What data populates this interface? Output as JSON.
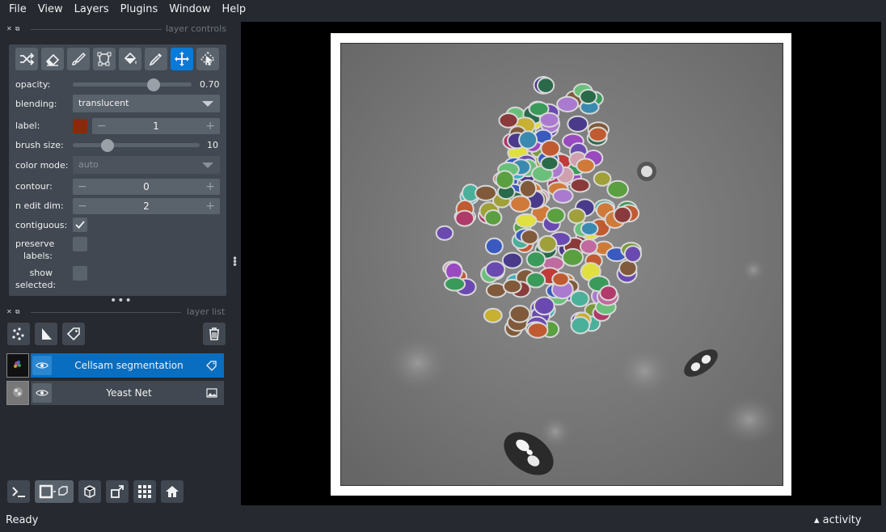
{
  "menu": [
    "File",
    "View",
    "Layers",
    "Plugins",
    "Window",
    "Help"
  ],
  "layer_controls": {
    "title": "layer controls",
    "tools": [
      {
        "icon": "shuffle-icon",
        "active": false
      },
      {
        "icon": "eraser-icon",
        "active": false
      },
      {
        "icon": "paintbrush-icon",
        "active": false
      },
      {
        "icon": "polygon-icon",
        "active": false
      },
      {
        "icon": "fill-bucket-icon",
        "active": false
      },
      {
        "icon": "color-picker-icon",
        "active": false
      },
      {
        "icon": "pan-zoom-icon",
        "active": true
      },
      {
        "icon": "transform-icon",
        "active": false
      }
    ],
    "opacity": {
      "label": "opacity:",
      "value": "0.70",
      "fraction": 0.7
    },
    "blending": {
      "label": "blending:",
      "value": "translucent"
    },
    "label": {
      "label": "label:",
      "value": "1",
      "color": "#8b2a0a"
    },
    "brush_size": {
      "label": "brush size:",
      "value": "10",
      "fraction": 0.25
    },
    "color_mode": {
      "label": "color mode:",
      "value": "auto"
    },
    "contour": {
      "label": "contour:",
      "value": "0"
    },
    "n_edit_dim": {
      "label": "n edit dim:",
      "value": "2"
    },
    "contiguous": {
      "label": "contiguous:",
      "checked": true
    },
    "preserve_labels": {
      "label_line1": "preserve",
      "label_line2": "labels:",
      "checked": false
    },
    "show_selected": {
      "label_line1": "show",
      "label_line2": "selected:",
      "checked": false
    }
  },
  "layer_list": {
    "title": "layer list",
    "layers": [
      {
        "name": "Cellsam segmentation",
        "type_icon": "label-tag-icon",
        "selected": true,
        "visible": true
      },
      {
        "name": "Yeast Net",
        "type_icon": "image-icon",
        "selected": false,
        "visible": true
      }
    ]
  },
  "status": {
    "text": "Ready",
    "activity": "activity"
  },
  "colors": {
    "accent": "#0a7ad8",
    "panel": "#414851",
    "background": "#262930"
  }
}
